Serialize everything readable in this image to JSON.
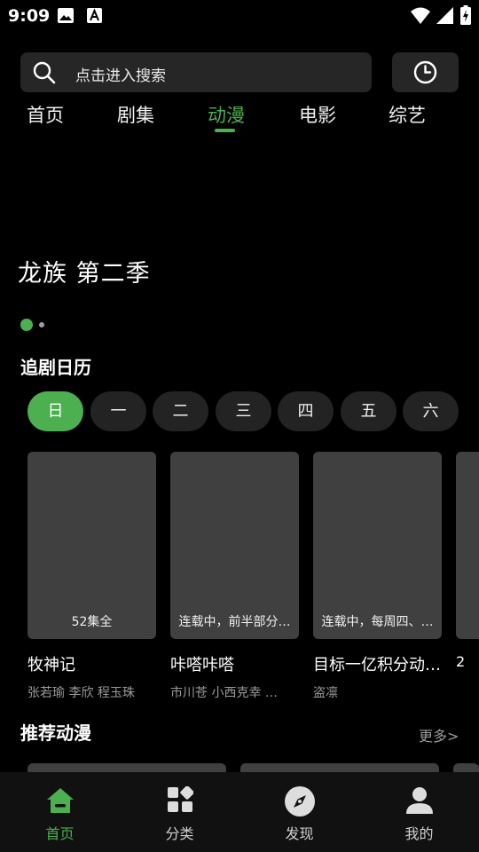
{
  "status_bar": {
    "time": "9:09"
  },
  "search": {
    "placeholder": "点击进入搜索"
  },
  "tabs": [
    {
      "label": "首页",
      "active": false
    },
    {
      "label": "剧集",
      "active": false
    },
    {
      "label": "动漫",
      "active": true
    },
    {
      "label": "电影",
      "active": false
    },
    {
      "label": "综艺",
      "active": false
    }
  ],
  "banner": {
    "title": "龙族  第二季",
    "pages": 2,
    "current_page": 1
  },
  "calendar": {
    "title": "追剧日历",
    "days": [
      "日",
      "一",
      "二",
      "三",
      "四",
      "五",
      "六"
    ],
    "selected_day": "日",
    "shows": [
      {
        "badge": "52集全",
        "title": "牧神记",
        "cast": "张若瑜  李欣  程玉珠"
      },
      {
        "badge": "连载中，前半部分…",
        "title": "咔嗒咔嗒",
        "cast": "市川苍  小西克幸  …"
      },
      {
        "badge": "连载中，每周四、…",
        "title": "目标一亿积分动…",
        "cast": "盗凛"
      },
      {
        "title_partial": "2"
      }
    ]
  },
  "recommend": {
    "title": "推荐动漫",
    "more": "更多>"
  },
  "bottom_nav": [
    {
      "label": "首页",
      "icon": "home-icon",
      "active": true
    },
    {
      "label": "分类",
      "icon": "category-icon",
      "active": false
    },
    {
      "label": "发现",
      "icon": "compass-icon",
      "active": false
    },
    {
      "label": "我的",
      "icon": "person-icon",
      "active": false
    }
  ],
  "colors": {
    "accent": "#4caf50",
    "background": "#000000",
    "surface": "#262626",
    "poster": "#404040"
  }
}
